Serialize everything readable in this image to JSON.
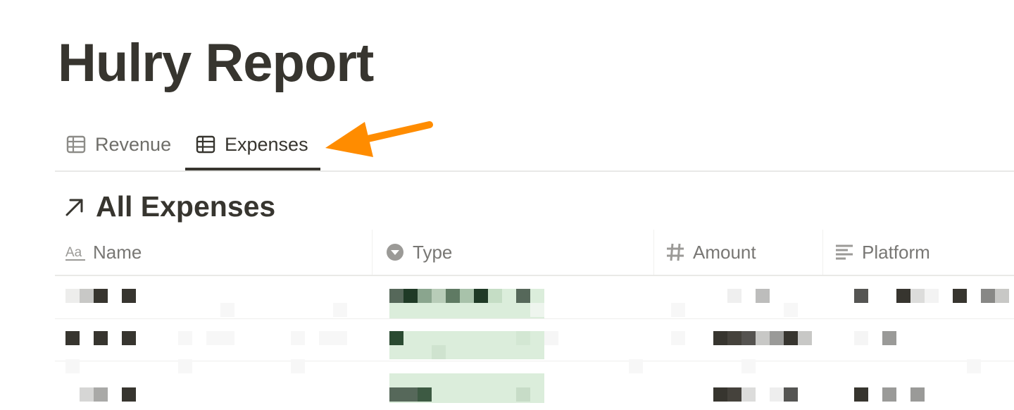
{
  "page": {
    "title": "Hulry Report"
  },
  "tabs": [
    {
      "label": "Revenue",
      "icon": "table-icon",
      "active": false
    },
    {
      "label": "Expenses",
      "icon": "table-icon",
      "active": true
    }
  ],
  "annotation": {
    "icon": "orange-arrow-icon",
    "color": "#ff8c00"
  },
  "section": {
    "title": "All Expenses",
    "icon": "arrow-up-right-icon"
  },
  "columns": [
    {
      "label": "Name",
      "icon": "text-property-icon"
    },
    {
      "label": "Type",
      "icon": "select-property-icon"
    },
    {
      "label": "Amount",
      "icon": "number-property-icon"
    },
    {
      "label": "Platform",
      "icon": "text-lines-property-icon"
    }
  ],
  "rows": [
    {
      "name": "",
      "type": "",
      "amount": "",
      "platform": ""
    },
    {
      "name": "",
      "type": "",
      "amount": "",
      "platform": ""
    },
    {
      "name": "",
      "type": "",
      "amount": "",
      "platform": ""
    }
  ],
  "colors": {
    "text": "#37352f",
    "muted": "#787774",
    "tag_green": "#dbeddb",
    "border": "#e9e9e7"
  }
}
